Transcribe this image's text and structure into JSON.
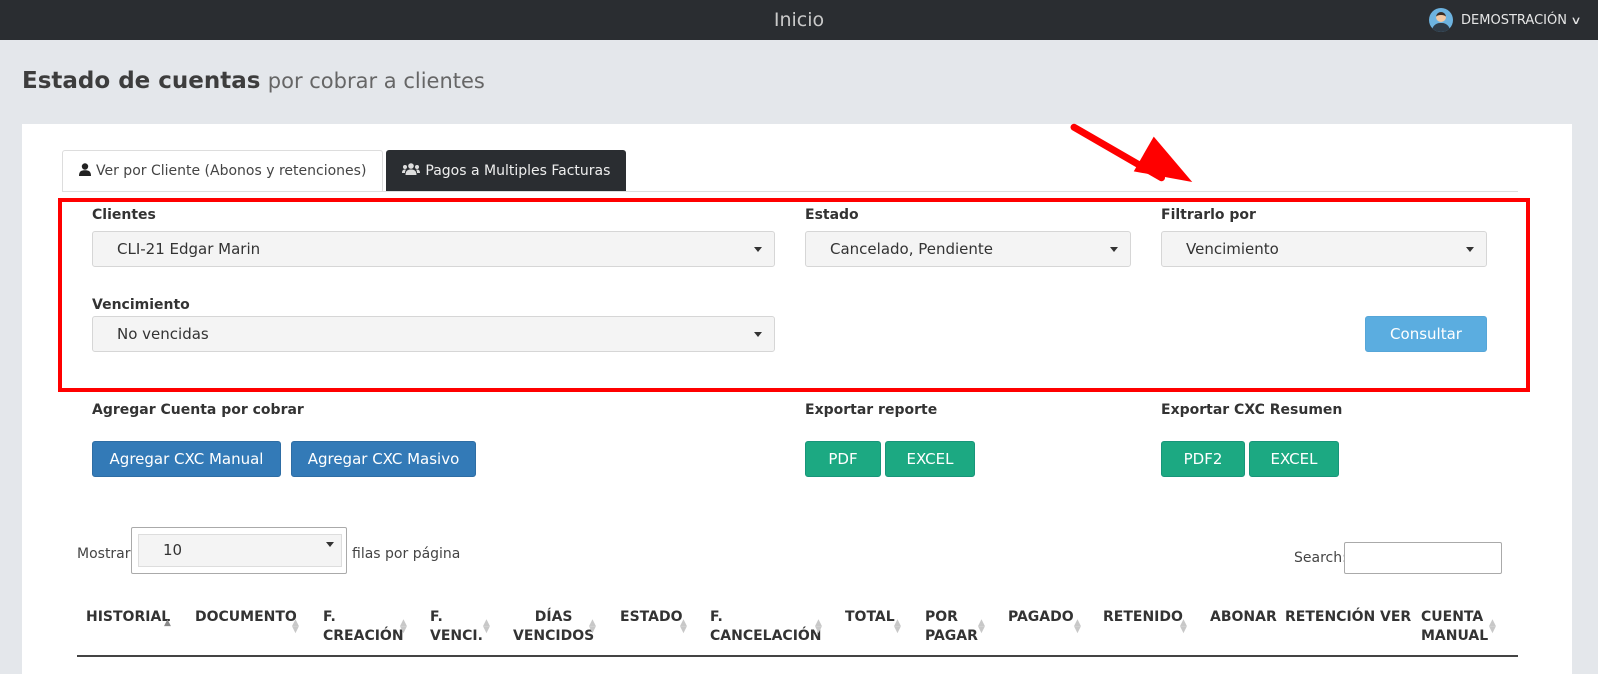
{
  "topbar": {
    "title": "Inicio",
    "user": "DEMOSTRACIÓN"
  },
  "page": {
    "title_bold": "Estado de cuentas",
    "title_rest": "por cobrar a clientes"
  },
  "tabs": [
    {
      "label": "Ver por Cliente (Abonos y retenciones)",
      "icon": "user-icon"
    },
    {
      "label": "Pagos a Multiples Facturas",
      "icon": "users-icon"
    }
  ],
  "filters": {
    "clientes_label": "Clientes",
    "clientes_value": "CLI-21 Edgar Marin",
    "estado_label": "Estado",
    "estado_value": "Cancelado, Pendiente",
    "filtrar_label": "Filtrarlo por",
    "filtrar_value": "Vencimiento",
    "vencimiento_label": "Vencimiento",
    "vencimiento_value": "No vencidas",
    "consultar": "Consultar"
  },
  "actions": {
    "agregar_label": "Agregar Cuenta por cobrar",
    "agregar_manual": "Agregar CXC Manual",
    "agregar_masivo": "Agregar CXC Masivo",
    "exportar_label": "Exportar reporte",
    "pdf": "PDF",
    "excel": "EXCEL",
    "resumen_label": "Exportar CXC Resumen",
    "pdf2": "PDF2",
    "excel2": "EXCEL"
  },
  "table_controls": {
    "mostrar": "Mostrar",
    "length": "10",
    "filas": "filas por página",
    "search": "Search:"
  },
  "columns": [
    {
      "line1": "",
      "line2": "HISTORIAL"
    },
    {
      "line1": "",
      "line2": "DOCUMENTO"
    },
    {
      "line1": "F.",
      "line2": "CREACIÓN"
    },
    {
      "line1": "F.",
      "line2": "VENCI."
    },
    {
      "line1": "DÍAS",
      "line2": "VENCIDOS"
    },
    {
      "line1": "",
      "line2": "ESTADO"
    },
    {
      "line1": "F.",
      "line2": "CANCELACIÓN"
    },
    {
      "line1": "",
      "line2": "TOTAL"
    },
    {
      "line1": "POR",
      "line2": "PAGAR"
    },
    {
      "line1": "",
      "line2": "PAGADO"
    },
    {
      "line1": "",
      "line2": "RETENIDO"
    },
    {
      "line1": "",
      "line2": "ABONAR"
    },
    {
      "line1": "",
      "line2": "RETENCIÓN"
    },
    {
      "line1": "",
      "line2": "VER"
    },
    {
      "line1": "CUENTA",
      "line2": "MANUAL"
    }
  ],
  "colors": {
    "annotation": "#ff0000",
    "primary": "#337ab7",
    "success": "#1ca982",
    "info": "#5bade0"
  }
}
